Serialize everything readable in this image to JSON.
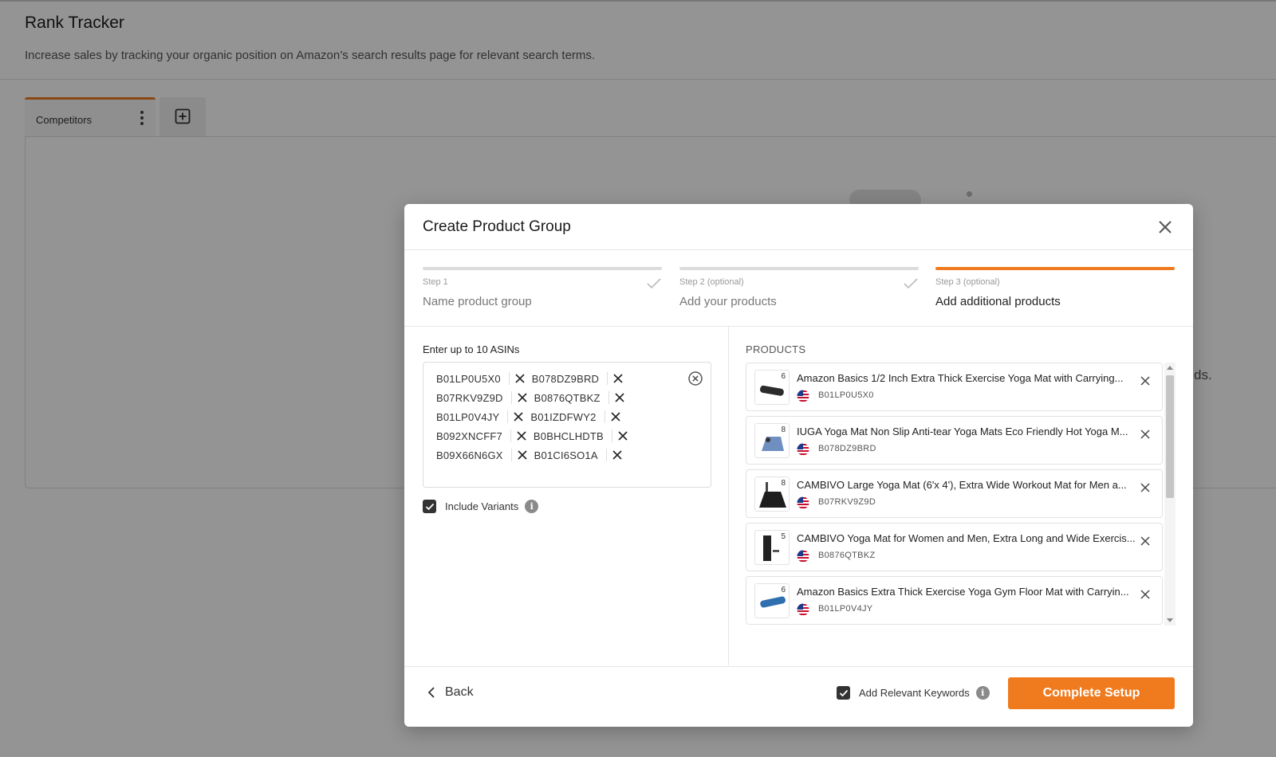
{
  "page": {
    "title": "Rank Tracker",
    "subtitle": "Increase sales by tracking your organic position on Amazon’s search results page for relevant search terms.",
    "tabs": [
      {
        "label": "Competitors"
      }
    ],
    "background_text": "ds."
  },
  "modal": {
    "title": "Create Product Group",
    "steps": [
      {
        "number": "Step 1",
        "label": "Name product group",
        "state": "done"
      },
      {
        "number": "Step 2 (optional)",
        "label": "Add your products",
        "state": "done"
      },
      {
        "number": "Step 3 (optional)",
        "label": "Add additional products",
        "state": "active"
      }
    ],
    "asin_input": {
      "label": "Enter up to 10 ASINs",
      "asins": [
        "B01LP0U5X0",
        "B078DZ9BRD",
        "B07RKV9Z9D",
        "B0876QTBKZ",
        "B01LP0V4JY",
        "B01IZDFWY2",
        "B092XNCFF7",
        "B0BHCLHDTB",
        "B09X66N6GX",
        "B01CI6SO1A"
      ]
    },
    "include_variants": {
      "label": "Include Variants",
      "checked": true,
      "info": "i"
    },
    "products_heading": "PRODUCTS",
    "products": [
      {
        "title": "Amazon Basics 1/2 Inch Extra Thick Exercise Yoga Mat with Carrying...",
        "asin": "B01LP0U5X0",
        "variant_count": "6",
        "color": "#2b2b2b"
      },
      {
        "title": "IUGA Yoga Mat Non Slip Anti-tear Yoga Mats Eco Friendly Hot Yoga M...",
        "asin": "B078DZ9BRD",
        "variant_count": "8",
        "color": "#6f8fc0"
      },
      {
        "title": "CAMBIVO Large Yoga Mat (6'x 4'), Extra Wide Workout Mat for Men a...",
        "asin": "B07RKV9Z9D",
        "variant_count": "8",
        "color": "#1e1e1e"
      },
      {
        "title": "CAMBIVO Yoga Mat for Women and Men, Extra Long and Wide Exercis...",
        "asin": "B0876QTBKZ",
        "variant_count": "5",
        "color": "#222222"
      },
      {
        "title": "Amazon Basics Extra Thick Exercise Yoga Gym Floor Mat with Carryin...",
        "asin": "B01LP0V4JY",
        "variant_count": "6",
        "color": "#2f6fb0"
      }
    ],
    "footer": {
      "back_label": "Back",
      "add_keywords": {
        "label": "Add Relevant Keywords",
        "checked": true,
        "info": "i"
      },
      "complete_label": "Complete Setup"
    }
  },
  "colors": {
    "accent": "#f07b1e",
    "overlay": "rgba(0,0,0,0.42)"
  }
}
